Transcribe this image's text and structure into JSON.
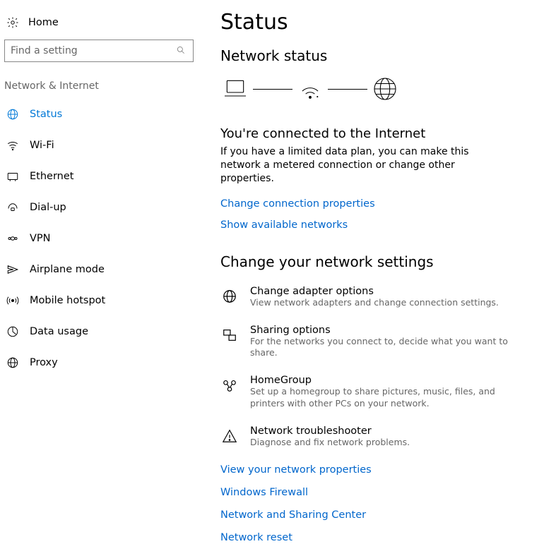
{
  "sidebar": {
    "home": "Home",
    "search_placeholder": "Find a setting",
    "category": "Network & Internet",
    "items": [
      {
        "label": "Status"
      },
      {
        "label": "Wi-Fi"
      },
      {
        "label": "Ethernet"
      },
      {
        "label": "Dial-up"
      },
      {
        "label": "VPN"
      },
      {
        "label": "Airplane mode"
      },
      {
        "label": "Mobile hotspot"
      },
      {
        "label": "Data usage"
      },
      {
        "label": "Proxy"
      }
    ]
  },
  "main": {
    "title": "Status",
    "status_section": "Network status",
    "connected_heading": "You're connected to the Internet",
    "connected_desc": "If you have a limited data plan, you can make this network a metered connection or change other properties.",
    "link_change_props": "Change connection properties",
    "link_show_networks": "Show available networks",
    "change_heading": "Change your network settings",
    "options": [
      {
        "title": "Change adapter options",
        "desc": "View network adapters and change connection settings."
      },
      {
        "title": "Sharing options",
        "desc": "For the networks you connect to, decide what you want to share."
      },
      {
        "title": "HomeGroup",
        "desc": "Set up a homegroup to share pictures, music, files, and printers with other PCs on your network."
      },
      {
        "title": "Network troubleshooter",
        "desc": "Diagnose and fix network problems."
      }
    ],
    "bottom_links": [
      "View your network properties",
      "Windows Firewall",
      "Network and Sharing Center",
      "Network reset"
    ]
  }
}
